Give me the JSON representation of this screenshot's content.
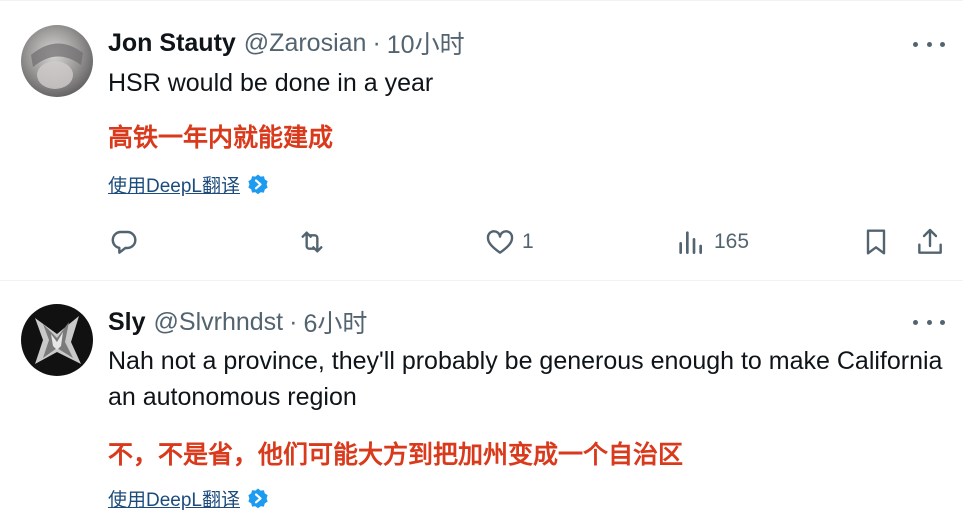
{
  "tweets": [
    {
      "display_name": "Jon Stauty",
      "handle": "@Zarosian",
      "separator": "·",
      "time": "10小时",
      "text": "HSR would be done in a year",
      "translation": "高铁一年内就能建成",
      "translate_link": "使用DeepL翻译",
      "reply_count": "",
      "retweet_count": "",
      "like_count": "1",
      "view_count": "165"
    },
    {
      "display_name": "Sly",
      "handle": "@Slvrhndst",
      "separator": "·",
      "time": "6小时",
      "text": "Nah not a province, they'll probably be generous enough to make California an autonomous region",
      "translation": "不，不是省，他们可能大方到把加州变成一个自治区",
      "translate_link": "使用DeepL翻译"
    }
  ],
  "colors": {
    "text": "#0f1419",
    "secondary": "#536471",
    "translation": "#d93a1c",
    "link": "#1d4c7c",
    "badge": "#1d9bf0",
    "divider": "#eff3f4"
  },
  "icons": [
    "reply-icon",
    "retweet-icon",
    "like-icon",
    "views-icon",
    "bookmark-icon",
    "share-icon",
    "more-icon",
    "verified-translate-icon"
  ]
}
